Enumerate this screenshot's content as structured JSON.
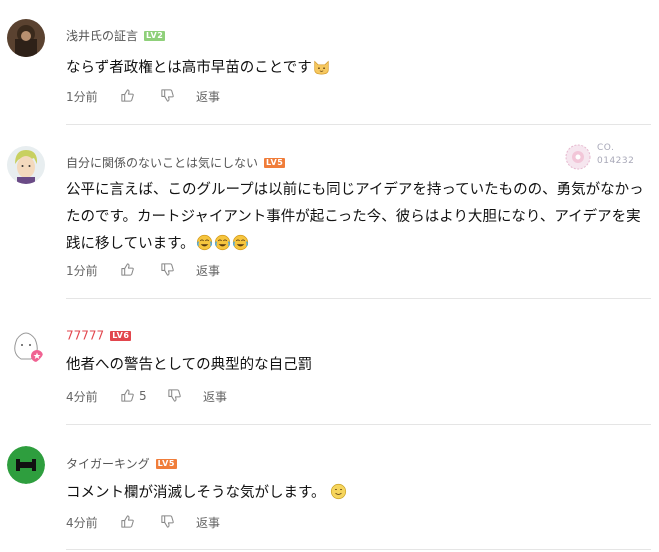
{
  "comments": [
    {
      "username": "浅井氏の証言",
      "level": "LV2",
      "text": "ならず者政権とは高市早苗のことです",
      "time": "1分前",
      "like_count": "",
      "reply_label": "返事"
    },
    {
      "username": "自分に関係のないことは気にしない",
      "level": "LV5",
      "text": "公平に言えば、このグループは以前にも同じアイデアを持っていたものの、勇気がなかったのです。カートジャイアント事件が起こった今、彼らはより大胆になり、アイデアを実践に移しています。",
      "time": "1分前",
      "like_count": "",
      "reply_label": "返事",
      "badge": {
        "code": "CO.",
        "number": "014232"
      }
    },
    {
      "username": "77777",
      "level": "LV6",
      "text": "他者への警告としての典型的な自己罰",
      "time": "4分前",
      "like_count": "5",
      "reply_label": "返事"
    },
    {
      "username": "タイガーキング",
      "level": "LV5",
      "text": "コメント欄が消滅しそうな気がします。",
      "time": "4分前",
      "like_count": "",
      "reply_label": "返事"
    }
  ],
  "icons": [
    "thumbs-up-icon",
    "thumbs-down-icon",
    "emoji-icon"
  ],
  "colors": {
    "level_green": "#8fd07a",
    "level_orange": "#f07d3a",
    "level_red": "#e2464d",
    "username": "#555555",
    "divider": "#e5e5e5"
  }
}
